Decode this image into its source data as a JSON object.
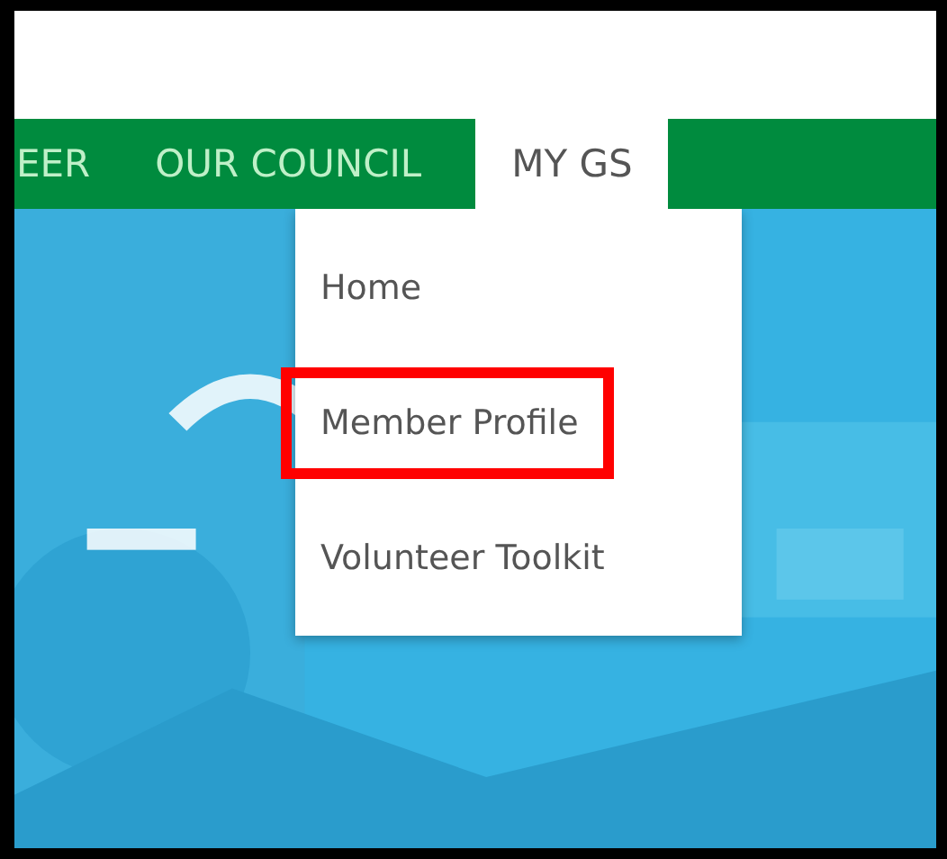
{
  "nav": {
    "items": [
      {
        "label": "EER",
        "selected": false
      },
      {
        "label": "OUR COUNCIL",
        "selected": false
      },
      {
        "label": "MY GS",
        "selected": true
      }
    ]
  },
  "dropdown": {
    "items": [
      {
        "label": "Home",
        "annotated": false
      },
      {
        "label": "Member Profile",
        "annotated": true
      },
      {
        "label": "Volunteer Toolkit",
        "annotated": false
      }
    ]
  }
}
